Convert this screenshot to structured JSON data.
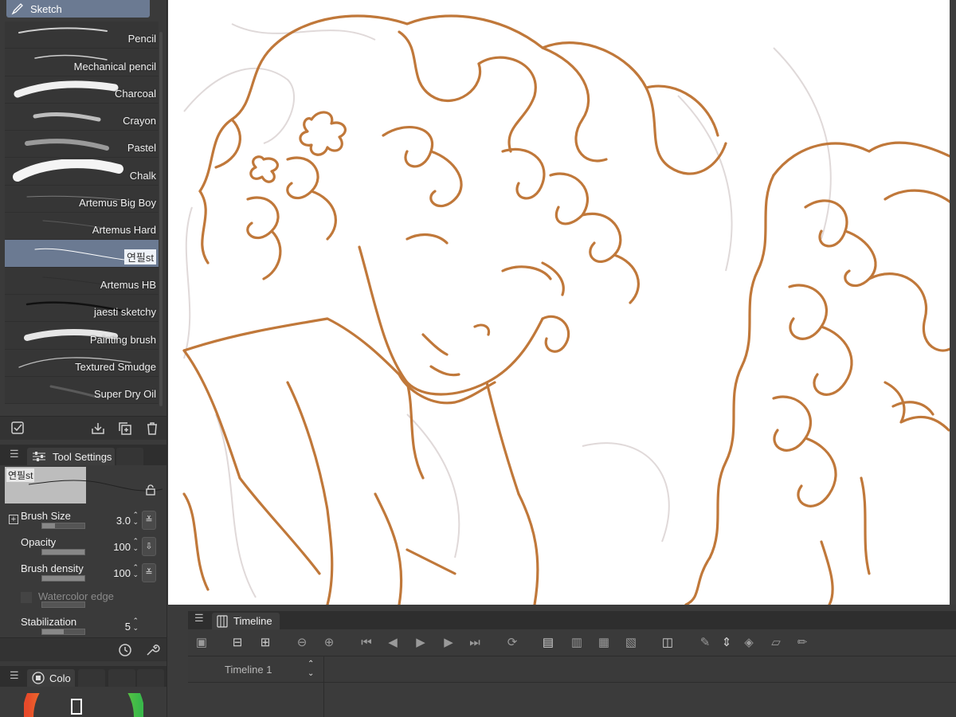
{
  "brush_panel": {
    "title": "Sketch",
    "brushes": [
      {
        "label": "Pencil",
        "selected": false
      },
      {
        "label": "Mechanical pencil",
        "selected": false
      },
      {
        "label": "Charcoal",
        "selected": false
      },
      {
        "label": "Crayon",
        "selected": false
      },
      {
        "label": "Pastel",
        "selected": false
      },
      {
        "label": "Chalk",
        "selected": false
      },
      {
        "label": "Artemus Big Boy",
        "selected": false
      },
      {
        "label": "Artemus Hard",
        "selected": false
      },
      {
        "label": "연필st",
        "selected": true
      },
      {
        "label": "Artemus HB",
        "selected": false
      },
      {
        "label": "jaesti sketchy",
        "selected": false
      },
      {
        "label": "Painting brush",
        "selected": false
      },
      {
        "label": "Textured Smudge",
        "selected": false
      },
      {
        "label": "Super Dry Oil",
        "selected": false
      }
    ]
  },
  "tool_settings": {
    "tab_label": "Tool Settings",
    "brush_name": "연필st",
    "properties": [
      {
        "name": "Brush Size",
        "value": "3.0",
        "level": 0.3
      },
      {
        "name": "Opacity",
        "value": "100",
        "level": 1.0
      },
      {
        "name": "Brush density",
        "value": "100",
        "level": 1.0
      },
      {
        "name": "Watercolor edge",
        "value": "",
        "level": 0
      },
      {
        "name": "Stabilization",
        "value": "5",
        "level": 0.5
      }
    ]
  },
  "color_panel": {
    "tab_label": "Colo"
  },
  "timeline": {
    "tab_label": "Timeline",
    "track_name": "Timeline 1"
  },
  "colors": {
    "accent_selected": "#6b7a92",
    "sketch_line": "#c0783a",
    "panel_bg": "#3a3a3a"
  }
}
